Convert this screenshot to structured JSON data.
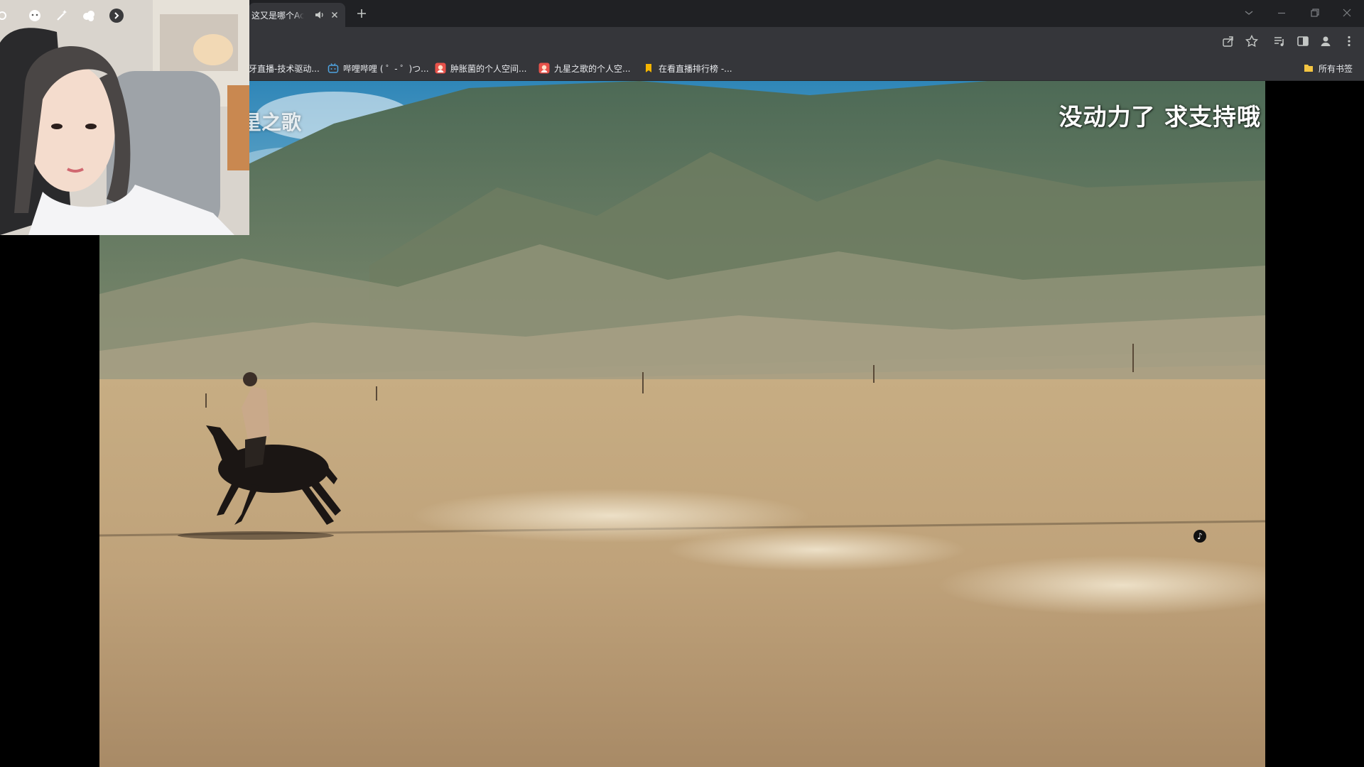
{
  "browser": {
    "tab": {
      "title": "这又是哪个Ac"
    },
    "bookmarks": [
      {
        "label": "牙直播-技术驱动...",
        "icon": "generic-page-icon"
      },
      {
        "label": "哔哩哔哩 ( ゜- ゜)つ...",
        "icon": "bilibili-tv-icon"
      },
      {
        "label": "肿胀菌的个人空间...",
        "icon": "avatar-favicon-icon"
      },
      {
        "label": "九星之歌的个人空...",
        "icon": "avatar-favicon-icon"
      },
      {
        "label": "在看直播排行榜 -...",
        "icon": "bookmark-flag-icon"
      }
    ],
    "all_bookmarks": {
      "label": "所有书签",
      "icon": "folder-icon"
    }
  },
  "video": {
    "overlay_title": "没动力了 求支持哦",
    "channel_watermark": "星之歌",
    "platform_badge_icon": "tiktok-icon"
  },
  "webcam": {
    "tools": [
      "settings-icon",
      "face-icon",
      "magic-wand-icon",
      "sticker-icon",
      "chevron-right-icon"
    ]
  },
  "colors": {
    "tabbar_bg": "#202124",
    "toolbar_bg": "#35363a",
    "text": "#e8eaed",
    "sky": "#3f8fb6",
    "ground": "#c9a77a"
  }
}
